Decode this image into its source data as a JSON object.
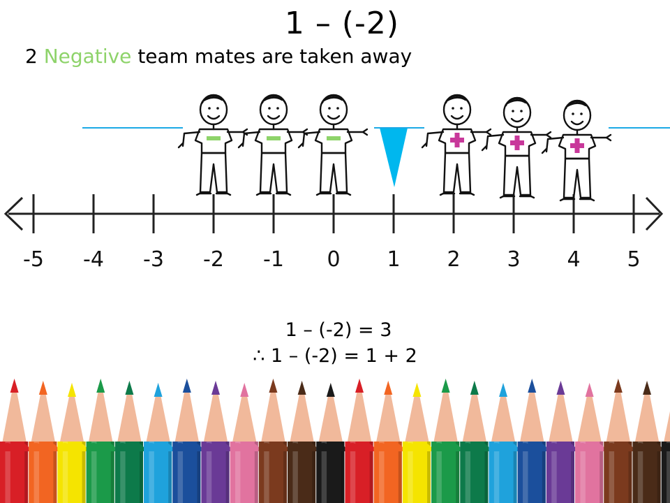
{
  "slide": {
    "title": "1 – (-2)",
    "subtitle_count": "2",
    "subtitle_keyword": "Negative",
    "subtitle_rest": "team mates are taken away"
  },
  "number_line": {
    "ticks": [
      "-5",
      "-4",
      "-3",
      "-2",
      "-1",
      "0",
      "1",
      "2",
      "3",
      "4",
      "5"
    ],
    "pointer_value": 1
  },
  "team": {
    "negative_at": [
      -2,
      -1,
      0
    ],
    "positive_at": [
      2,
      3,
      4
    ],
    "negative_symbol_color": "#8ed36a",
    "positive_symbol_color": "#c8389a"
  },
  "equations": {
    "line1": "1 – (-2) = 3",
    "line2": "∴ 1 – (-2) = 1 + 2"
  },
  "colors": {
    "pointer": "#00b7ee",
    "rope": "#1ca9e6",
    "pencils": [
      "#d81f26",
      "#f26522",
      "#f5e400",
      "#1b9a49",
      "#0d7a4a",
      "#1fa2dc",
      "#1b4f9c",
      "#6a3a96",
      "#e1739f",
      "#7b3a1e",
      "#4a2b18",
      "#1a1a1a",
      "#d81f26",
      "#f26522",
      "#f5e400",
      "#1b9a49",
      "#0d7a4a",
      "#1fa2dc",
      "#1b4f9c",
      "#6a3a96",
      "#e1739f",
      "#7b3a1e",
      "#4a2b18",
      "#1a1a1a"
    ]
  }
}
